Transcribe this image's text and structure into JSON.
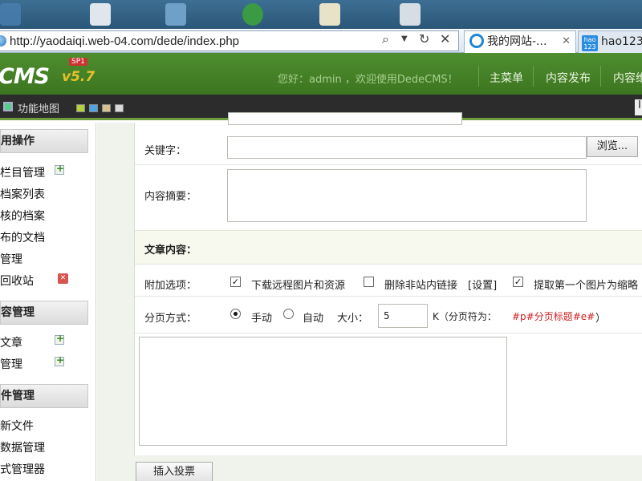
{
  "browser": {
    "url": "http://yaodaiqi.web-04.com/dede/index.php",
    "tabs": [
      {
        "label": "我的网站-...",
        "close": "✕"
      },
      {
        "label": "hao123",
        "icon_text": "hao\n123"
      }
    ]
  },
  "header": {
    "logo": "CMS",
    "version": "v5.7",
    "badge": "SP1",
    "greeting": "您好：admin ，欢迎使用DedeCMS！",
    "nav": [
      "主菜单",
      "内容发布",
      "内容维"
    ]
  },
  "toolbar": {
    "site_map": "功能地图",
    "right_glyph": "I",
    "swatch_colors": [
      "#b5d13d",
      "#4fa3e0",
      "#d6c193",
      "#d9d9d9"
    ]
  },
  "sidebar": {
    "sections": [
      {
        "title": "用操作",
        "items": [
          "栏目管理",
          "档案列表",
          "核的档案",
          "布的文档",
          "管理",
          "回收站"
        ]
      },
      {
        "title": "容管理",
        "items": [
          "文章",
          "管理"
        ]
      },
      {
        "title": "件管理",
        "items": [
          "新文件",
          "数据管理",
          "式管理器"
        ]
      }
    ]
  },
  "form": {
    "keywords_label": "关键字：",
    "keywords_value": "",
    "browse_button": "浏览...",
    "summary_label": "内容摘要：",
    "summary_value": "",
    "section_title": "文章内容：",
    "options_label": "附加选项：",
    "options": [
      {
        "label": "下载远程图片和资源",
        "checked": true
      },
      {
        "label": "删除非站内链接",
        "checked": false
      },
      {
        "label": "[设置]"
      },
      {
        "label": "提取第一个图片为缩略",
        "checked": true
      }
    ],
    "paging_label": "分页方式：",
    "paging_manual": "手动",
    "paging_auto": "自动",
    "size_label": "大小：",
    "size_value": "5",
    "size_unit": "K（分页符为：",
    "page_marker": "#p#分页标题#e#",
    "close_paren": "）",
    "insert_vote": "插入投票"
  }
}
